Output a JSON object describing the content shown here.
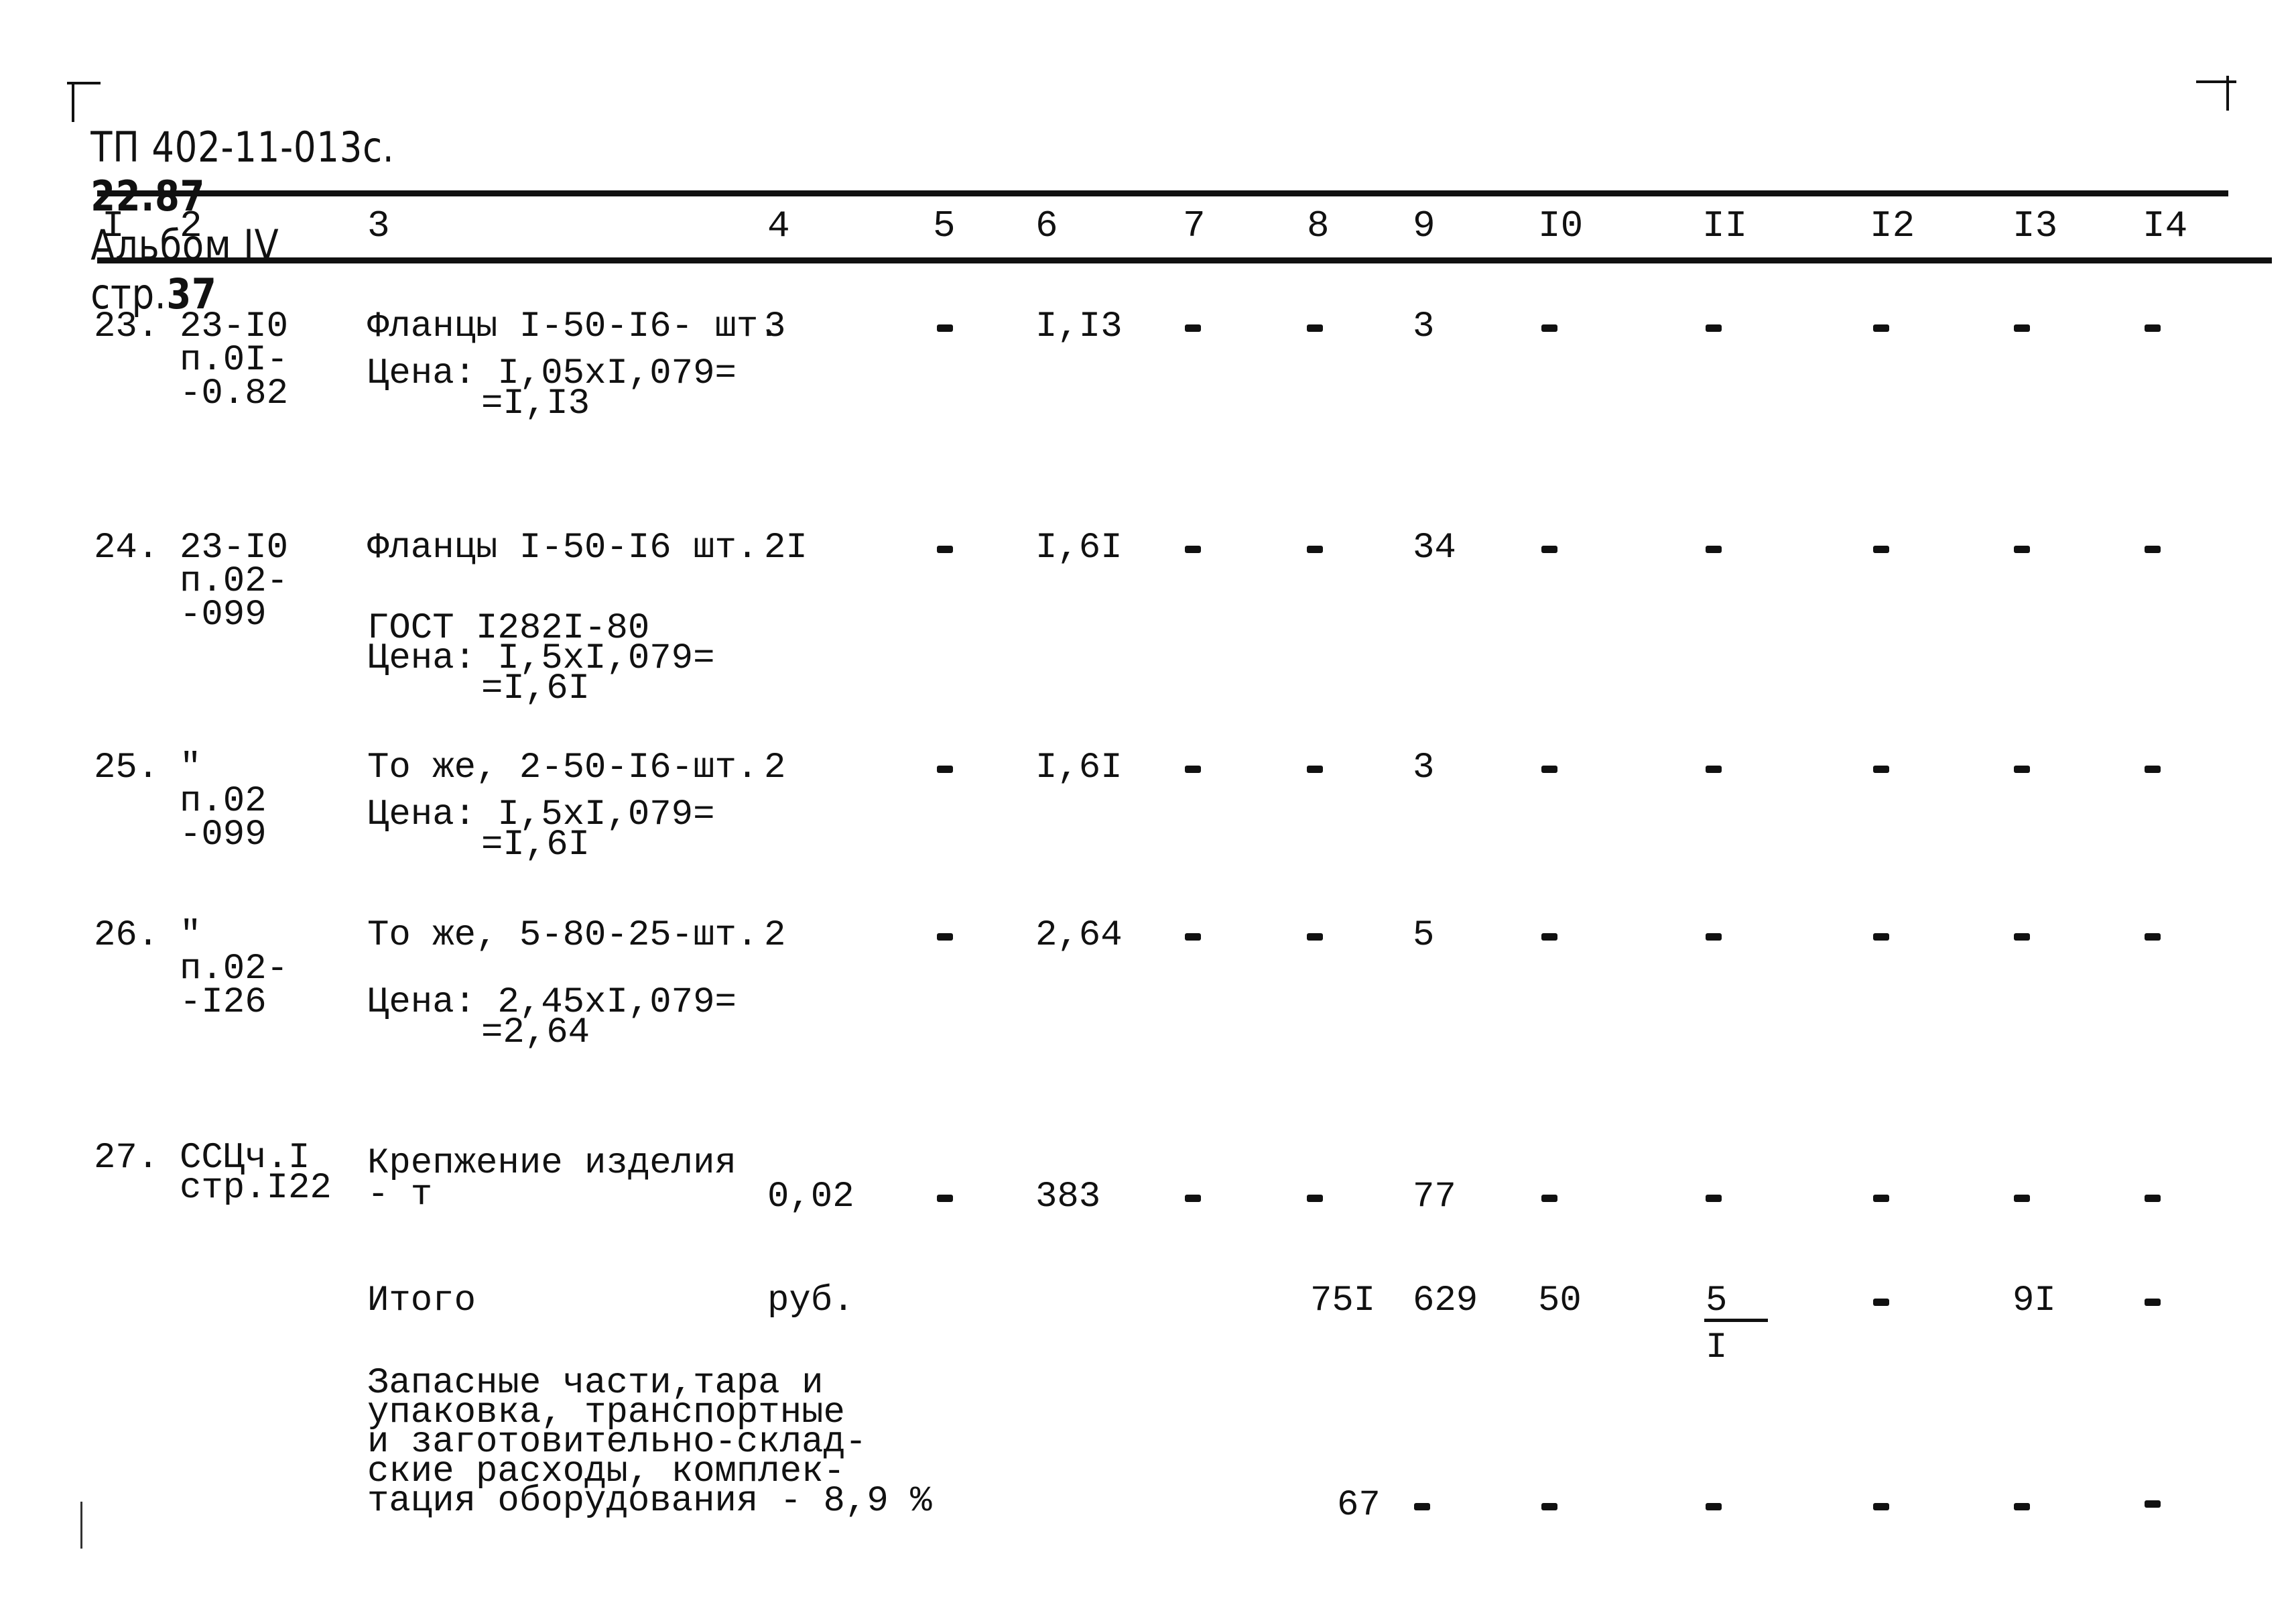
{
  "header": {
    "doc_code": "ТП 402-11-013с.",
    "doc_code_bold": "22.87",
    "album": "Альбом IV",
    "page_label": "стр.",
    "page_number": "37"
  },
  "columns": [
    "I",
    "2",
    "3",
    "4",
    "5",
    "6",
    "7",
    "8",
    "9",
    "I0",
    "II",
    "I2",
    "I3",
    "I4"
  ],
  "rows": [
    {
      "no": "23.",
      "code": [
        "23-I0",
        "п.0I-",
        "-0.82"
      ],
      "desc": [
        "Фланцы I-50-I6- шт.",
        "Цена: I,05xI,079=",
        "=I,I3"
      ],
      "c4": "3",
      "c5": "-",
      "c6": "I,I3",
      "c7": "-",
      "c8": "-",
      "c9": "3",
      "c10": "-",
      "c11": "-",
      "c12": "-",
      "c13": "-",
      "c14": "-"
    },
    {
      "no": "24.",
      "code": [
        "23-I0",
        "п.02-",
        "-099"
      ],
      "desc": [
        "Фланцы I-50-I6 шт.",
        "ГОСТ I282I-80",
        "Цена: I,5xI,079=",
        "=I,6I"
      ],
      "c4": "2I",
      "c5": "-",
      "c6": "I,6I",
      "c7": "-",
      "c8": "-",
      "c9": "34",
      "c10": "-",
      "c11": "-",
      "c12": "-",
      "c13": "-",
      "c14": "-"
    },
    {
      "no": "25.",
      "code": [
        "\"",
        "п.02",
        "-099"
      ],
      "desc": [
        "То же, 2-50-I6-шт.",
        "Цена: I,5xI,079=",
        "=I,6I"
      ],
      "c4": "2",
      "c5": "-",
      "c6": "I,6I",
      "c7": "-",
      "c8": "-",
      "c9": "3",
      "c10": "-",
      "c11": "-",
      "c12": "-",
      "c13": "-",
      "c14": "-"
    },
    {
      "no": "26.",
      "code": [
        "\"",
        "п.02-",
        "-I26"
      ],
      "desc": [
        "То же, 5-80-25-шт.",
        "Цена: 2,45xI,079=",
        "=2,64"
      ],
      "c4": "2",
      "c5": "-",
      "c6": "2,64",
      "c7": "-",
      "c8": "-",
      "c9": "5",
      "c10": "-",
      "c11": "-",
      "c12": "-",
      "c13": "-",
      "c14": "-"
    },
    {
      "no": "27.",
      "code": [
        "ССЦч.I",
        "стр.I22"
      ],
      "desc": [
        "Крепжение изделия",
        "- т"
      ],
      "c4": "0,02",
      "c5": "-",
      "c6": "383",
      "c7": "-",
      "c8": "-",
      "c9": "77",
      "c10": "-",
      "c11": "-",
      "c12": "-",
      "c13": "-",
      "c14": "-"
    }
  ],
  "total": {
    "label": "Итого",
    "unit": "руб.",
    "c8": "75I",
    "c9": "629",
    "c10": "50",
    "c11_num": "5",
    "c11_den": "I",
    "c12": "-",
    "c13": "9I",
    "c14": "-"
  },
  "spare": {
    "desc": [
      "Запасные части,тара и",
      "упаковка, транспортные",
      "и заготовительно-склад-",
      "ские расходы, комплек-",
      "тация оборудования - 8,9 %"
    ],
    "c8": "67",
    "c9": "-",
    "c10": "-",
    "c11": "-",
    "c12": "-",
    "c13": "-",
    "c14": "-"
  }
}
